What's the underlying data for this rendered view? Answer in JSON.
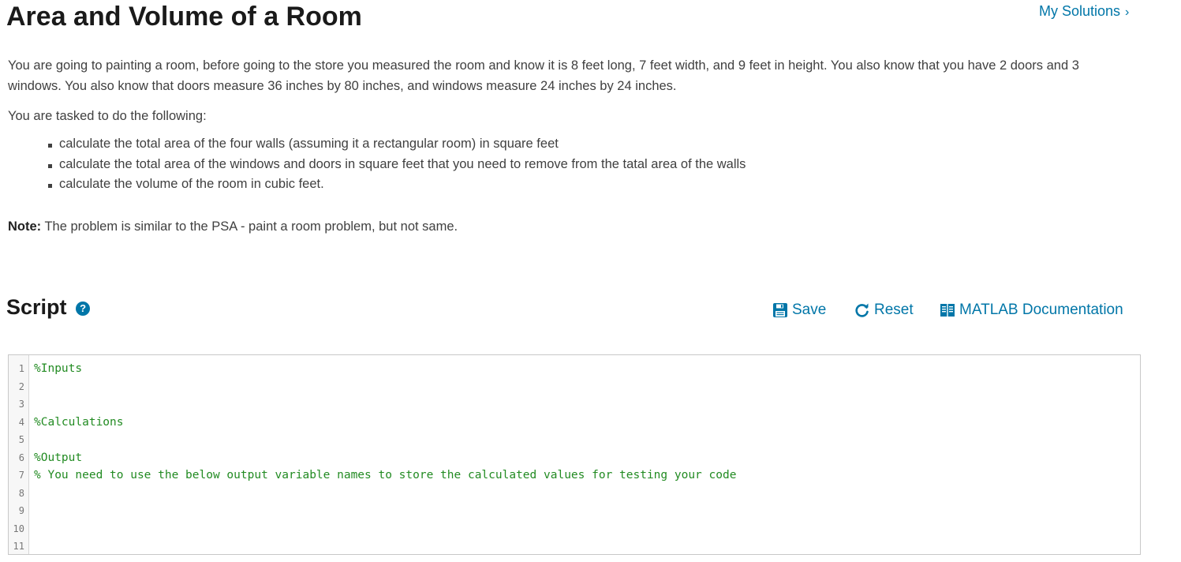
{
  "header": {
    "title": "Area and Volume of a Room",
    "my_solutions": "My Solutions",
    "my_solutions_chevron": "›"
  },
  "description": {
    "paragraph1": "You are going to painting a room, before going to the store you measured the room and know it is 8 feet long, 7 feet width, and 9 feet in height. You also know that you have 2 doors and 3 windows. You also know that doors measure 36 inches by 80 inches, and windows measure 24 inches by 24 inches.",
    "paragraph2": "You are tasked to do the following:",
    "tasks": [
      "calculate the total area of the four walls (assuming it a rectangular room) in square feet",
      "calculate the total area of the windows and doors in square feet that you need to remove from the tatal area of the walls",
      "calculate the volume of the room in cubic feet."
    ],
    "note_label": "Note:",
    "note_text": " The problem is similar to the PSA - paint a room problem, but not same."
  },
  "script": {
    "title": "Script",
    "help_icon": "?",
    "save_label": "Save",
    "reset_label": "Reset",
    "docs_label": "MATLAB Documentation",
    "lines": [
      {
        "num": "1",
        "text": "%Inputs"
      },
      {
        "num": "2",
        "text": ""
      },
      {
        "num": "3",
        "text": ""
      },
      {
        "num": "4",
        "text": "%Calculations"
      },
      {
        "num": "5",
        "text": ""
      },
      {
        "num": "6",
        "text": "%Output"
      },
      {
        "num": "7",
        "text": "% You need to use the below output variable names to store the calculated values for testing your code"
      },
      {
        "num": "8",
        "text": ""
      },
      {
        "num": "9",
        "text": ""
      },
      {
        "num": "10",
        "text": ""
      },
      {
        "num": "11",
        "text": ""
      }
    ]
  },
  "colors": {
    "link": "#0076a8",
    "comment": "#228b22",
    "heading": "#1a1a1a",
    "body_text": "#404040"
  },
  "icons": {
    "save": "floppy-disk-icon",
    "reset": "refresh-icon",
    "docs": "book-icon",
    "help": "question-circle-icon"
  }
}
